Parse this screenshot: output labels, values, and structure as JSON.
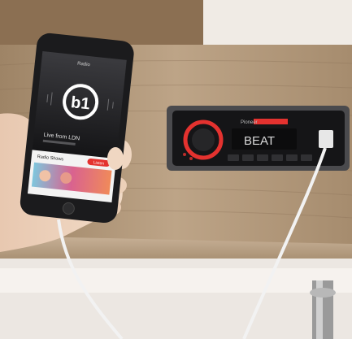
{
  "phone": {
    "status_label": "Radio",
    "station_logo": "b1",
    "track_label": "Live from LDN",
    "section_label": "Radio Shows",
    "action_label": "Listen"
  },
  "radio": {
    "brand": "Pioneer",
    "display_text": "BEAT"
  },
  "colors": {
    "wood": "#b59d80",
    "radio_accent": "#e4322f",
    "phone_body": "#1b1b1d"
  }
}
